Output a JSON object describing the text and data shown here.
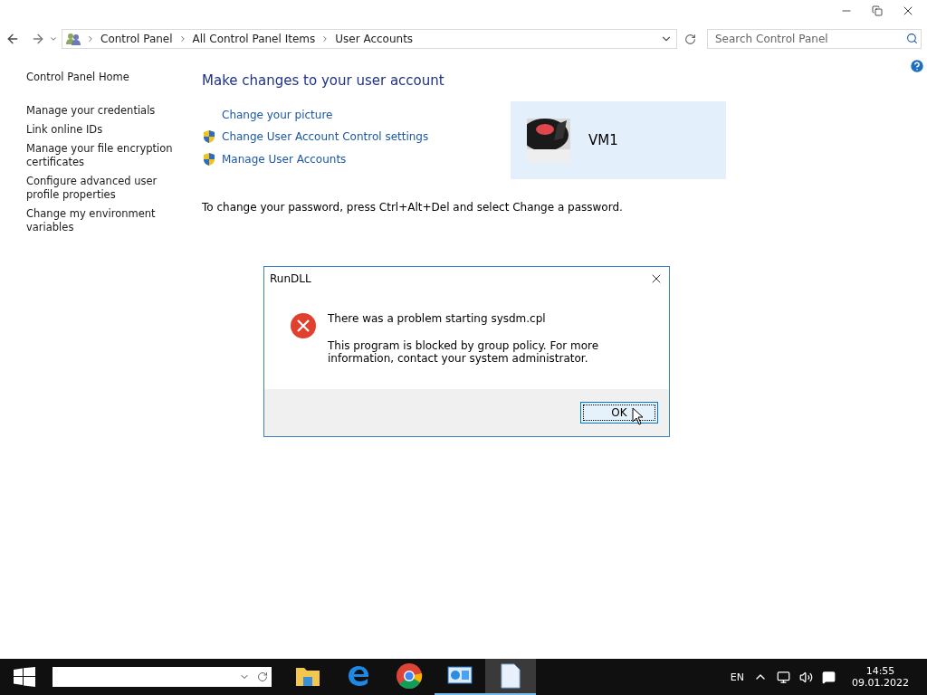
{
  "address_bar": {
    "crumbs": [
      "Control Panel",
      "All Control Panel Items",
      "User Accounts"
    ]
  },
  "search": {
    "placeholder": "Search Control Panel"
  },
  "sidebar": {
    "home": "Control Panel Home",
    "items": [
      "Manage your credentials",
      "Link online IDs",
      "Manage your file encryption certificates",
      "Configure advanced user profile properties",
      "Change my environment variables"
    ]
  },
  "main": {
    "heading": "Make changes to your user account",
    "links": [
      {
        "label": "Change your picture",
        "kind": "plain"
      },
      {
        "label": "Change User Account Control settings",
        "kind": "shield"
      },
      {
        "label": "Manage User Accounts",
        "kind": "shield"
      }
    ],
    "account": {
      "name": "VM1"
    },
    "note": "To change your password, press Ctrl+Alt+Del and select Change a password."
  },
  "dialog": {
    "title": "RunDLL",
    "heading": "There was a problem starting sysdm.cpl",
    "message": "This program is blocked by group policy. For more information, contact your system administrator.",
    "button": "OK"
  },
  "taskbar": {
    "apps": [
      {
        "kind": "folder",
        "running": false,
        "selected": false
      },
      {
        "kind": "edge",
        "running": false,
        "selected": false
      },
      {
        "kind": "chrome",
        "running": false,
        "selected": false
      },
      {
        "kind": "panel",
        "running": true,
        "selected": false
      },
      {
        "kind": "document",
        "running": true,
        "selected": true
      }
    ],
    "language": "EN",
    "time": "14:55",
    "date": "09.01.2022"
  }
}
